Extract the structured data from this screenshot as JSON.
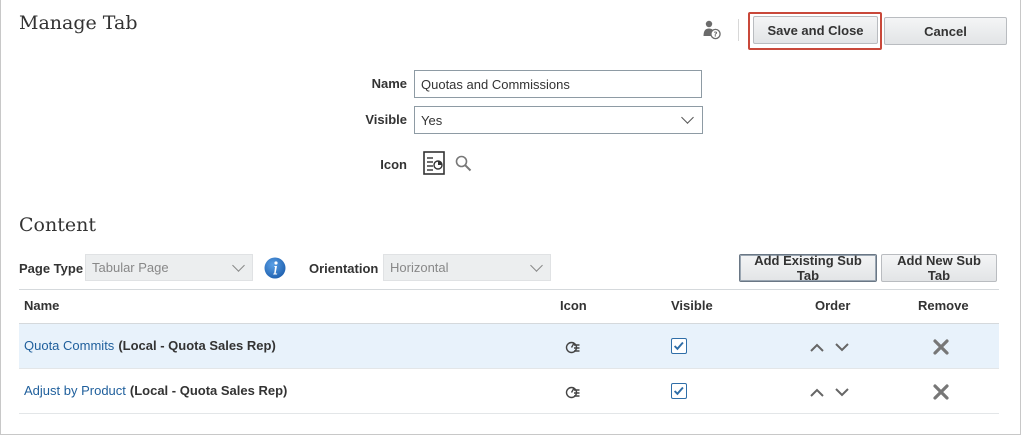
{
  "header": {
    "title": "Manage Tab",
    "save_label": "Save and Close",
    "cancel_label": "Cancel",
    "help_icon": "user-help-icon"
  },
  "form": {
    "name_label": "Name",
    "name_value": "Quotas and Commissions",
    "visible_label": "Visible",
    "visible_value": "Yes",
    "icon_label": "Icon"
  },
  "content": {
    "title": "Content",
    "page_type_label": "Page Type",
    "page_type_value": "Tabular Page",
    "orientation_label": "Orientation",
    "orientation_value": "Horizontal",
    "add_existing_label": "Add Existing Sub Tab",
    "add_new_label": "Add New Sub Tab"
  },
  "table": {
    "columns": [
      "Name",
      "Icon",
      "Visible",
      "Order",
      "Remove"
    ],
    "rows": [
      {
        "name": "Quota Commits",
        "suffix": "(Local - Quota Sales Rep)",
        "visible": true,
        "selected": true
      },
      {
        "name": "Adjust by Product",
        "suffix": "(Local - Quota Sales Rep)",
        "visible": true,
        "selected": false
      }
    ]
  },
  "colors": {
    "accent": "#2f6ea8",
    "link": "#1f5f9c",
    "highlight": "#c9483a",
    "selected_row": "#e8f2fb"
  }
}
